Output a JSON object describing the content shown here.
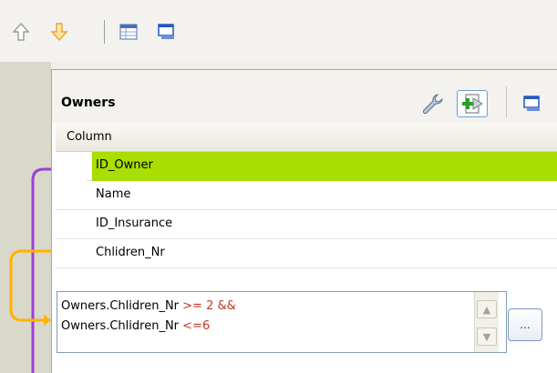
{
  "panel": {
    "title": "Owners",
    "column_header": "Column"
  },
  "rows": [
    {
      "label": "ID_Owner",
      "selected": true
    },
    {
      "label": "Name",
      "selected": false
    },
    {
      "label": "ID_Insurance",
      "selected": false
    },
    {
      "label": "Chlidren_Nr",
      "selected": false
    }
  ],
  "expression": {
    "line1_prefix": "Owners.Chlidren_Nr ",
    "line1_op": ">= 2 &&",
    "line2_prefix": "Owners.Chlidren_Nr ",
    "line2_op": "<=6"
  },
  "ellipsis_button": "...",
  "icons": {
    "toolbar": [
      "up-arrow-icon",
      "down-arrow-icon",
      "table-icon",
      "window-icon"
    ],
    "panel": [
      "wrench-icon",
      "add-column-icon",
      "window-icon"
    ]
  },
  "colors": {
    "selection": "#a8de00",
    "operator_text": "#c0392b",
    "link_purple": "#9b3fd6",
    "link_orange": "#ffb300"
  }
}
